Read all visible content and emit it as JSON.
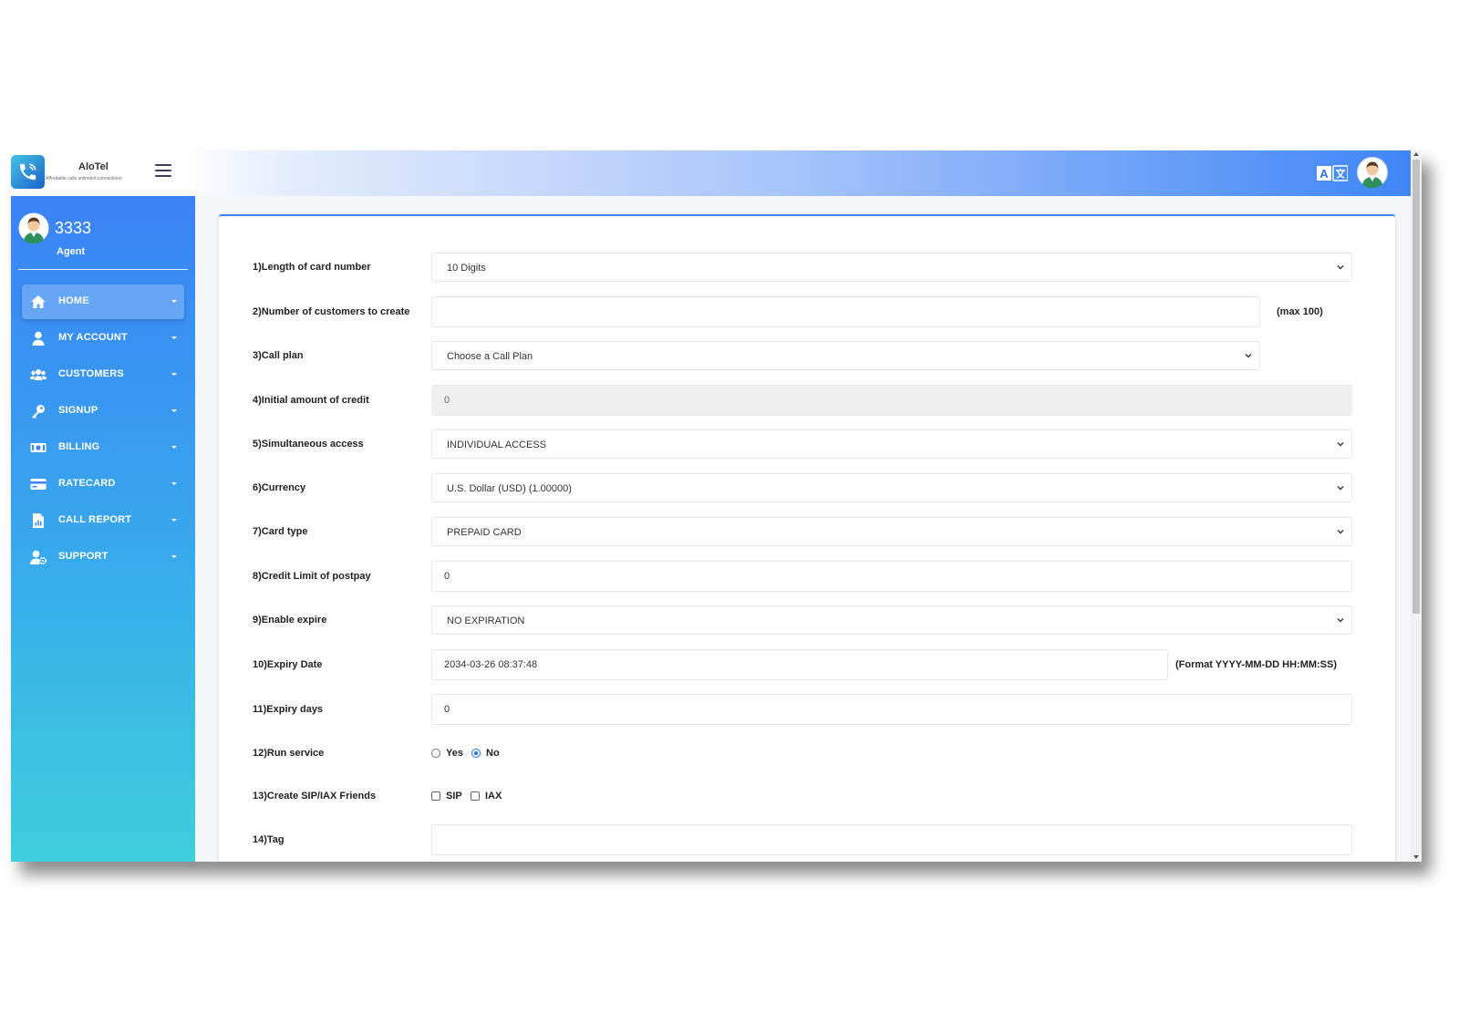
{
  "brand": {
    "name": "AloTel",
    "tagline": "Affordable calls unlimited connections"
  },
  "profile": {
    "name": "3333",
    "role": "Agent"
  },
  "nav": [
    {
      "label": "HOME",
      "icon": "home-icon"
    },
    {
      "label": "MY ACCOUNT",
      "icon": "user-icon"
    },
    {
      "label": "CUSTOMERS",
      "icon": "users-icon"
    },
    {
      "label": "SIGNUP",
      "icon": "key-icon"
    },
    {
      "label": "BILLING",
      "icon": "money-icon"
    },
    {
      "label": "RATECARD",
      "icon": "credit-card-icon"
    },
    {
      "label": "CALL REPORT",
      "icon": "file-chart-icon"
    },
    {
      "label": "SUPPORT",
      "icon": "user-cog-icon"
    }
  ],
  "form": {
    "length_card_number": {
      "label": "1)Length of card number",
      "value": "10 Digits"
    },
    "num_customers": {
      "label": "2)Number of customers to create",
      "value": "",
      "note": "(max 100)"
    },
    "call_plan": {
      "label": "3)Call plan",
      "value": "Choose a Call Plan"
    },
    "initial_credit": {
      "label": "4)Initial amount of credit",
      "value": "0"
    },
    "simultaneous_access": {
      "label": "5)Simultaneous access",
      "value": "INDIVIDUAL ACCESS"
    },
    "currency": {
      "label": "6)Currency",
      "value": "U.S. Dollar (USD) (1.00000)"
    },
    "card_type": {
      "label": "7)Card type",
      "value": "PREPAID CARD"
    },
    "credit_limit": {
      "label": "8)Credit Limit of postpay",
      "value": "0"
    },
    "enable_expire": {
      "label": "9)Enable expire",
      "value": "NO EXPIRATION"
    },
    "expiry_date": {
      "label": "10)Expiry Date",
      "value": "2034-03-26 08:37:48",
      "note": "(Format YYYY-MM-DD HH:MM:SS)"
    },
    "expiry_days": {
      "label": "11)Expiry days",
      "value": "0"
    },
    "run_service": {
      "label": "12)Run service",
      "yes": "Yes",
      "no": "No",
      "selected": "No"
    },
    "sip_iax": {
      "label": "13)Create SIP/IAX Friends",
      "sip": "SIP",
      "iax": "IAX"
    },
    "tag": {
      "label": "14)Tag",
      "value": ""
    }
  },
  "colors": {
    "accent": "#3b82f6",
    "sidebar_top": "#3b82f6",
    "sidebar_bottom": "#3fcfdc"
  }
}
